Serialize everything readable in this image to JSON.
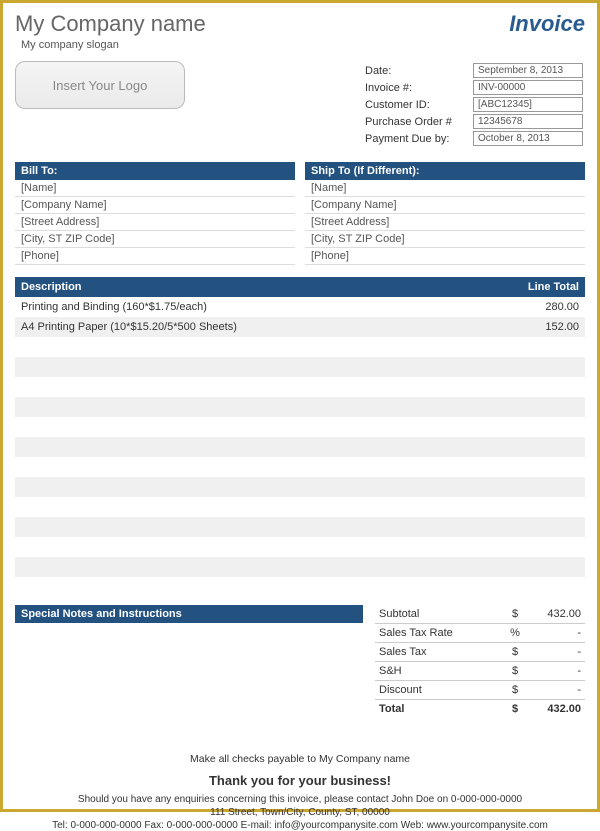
{
  "header": {
    "company_name": "My Company name",
    "company_slogan": "My company slogan",
    "invoice_title": "Invoice",
    "logo_placeholder": "Insert Your Logo"
  },
  "meta": {
    "date_label": "Date:",
    "date_value": "September 8, 2013",
    "invoice_no_label": "Invoice #:",
    "invoice_no_value": "INV-00000",
    "customer_id_label": "Customer ID:",
    "customer_id_value": "[ABC12345]",
    "po_label": "Purchase Order #",
    "po_value": "12345678",
    "due_label": "Payment Due by:",
    "due_value": "October 8, 2013"
  },
  "bill_to": {
    "header": "Bill To:",
    "lines": [
      "[Name]",
      "[Company Name]",
      "[Street Address]",
      "[City, ST  ZIP Code]",
      "[Phone]"
    ]
  },
  "ship_to": {
    "header": "Ship To (If Different):",
    "lines": [
      "[Name]",
      "[Company Name]",
      "[Street Address]",
      "[City, ST  ZIP Code]",
      "[Phone]"
    ]
  },
  "items": {
    "desc_header": "Description",
    "total_header": "Line Total",
    "rows": [
      {
        "desc": "Printing and Binding (160*$1.75/each)",
        "total": "280.00"
      },
      {
        "desc": "A4 Printing Paper (10*$15.20/5*500 Sheets)",
        "total": "152.00"
      },
      {
        "desc": "",
        "total": ""
      },
      {
        "desc": "",
        "total": ""
      },
      {
        "desc": "",
        "total": ""
      },
      {
        "desc": "",
        "total": ""
      },
      {
        "desc": "",
        "total": ""
      },
      {
        "desc": "",
        "total": ""
      },
      {
        "desc": "",
        "total": ""
      },
      {
        "desc": "",
        "total": ""
      },
      {
        "desc": "",
        "total": ""
      },
      {
        "desc": "",
        "total": ""
      },
      {
        "desc": "",
        "total": ""
      },
      {
        "desc": "",
        "total": ""
      },
      {
        "desc": "",
        "total": ""
      }
    ]
  },
  "notes": {
    "header": "Special Notes and Instructions"
  },
  "totals": {
    "subtotal_label": "Subtotal",
    "subtotal_sym": "$",
    "subtotal_val": "432.00",
    "taxrate_label": "Sales Tax Rate",
    "taxrate_sym": "%",
    "taxrate_val": "-",
    "salestax_label": "Sales Tax",
    "salestax_sym": "$",
    "salestax_val": "-",
    "sh_label": "S&H",
    "sh_sym": "$",
    "sh_val": "-",
    "discount_label": "Discount",
    "discount_sym": "$",
    "discount_val": "-",
    "total_label": "Total",
    "total_sym": "$",
    "total_val": "432.00"
  },
  "footer": {
    "checks": "Make all checks payable to My Company name",
    "thanks": "Thank you for your business!",
    "enquiry": "Should you have any enquiries concerning this invoice, please contact John Doe on 0-000-000-0000",
    "address": "111 Street, Town/City, County, ST, 00000",
    "contact": "Tel: 0-000-000-0000 Fax: 0-000-000-0000 E-mail: info@yourcompanysite.com Web: www.yourcompanysite.com"
  }
}
